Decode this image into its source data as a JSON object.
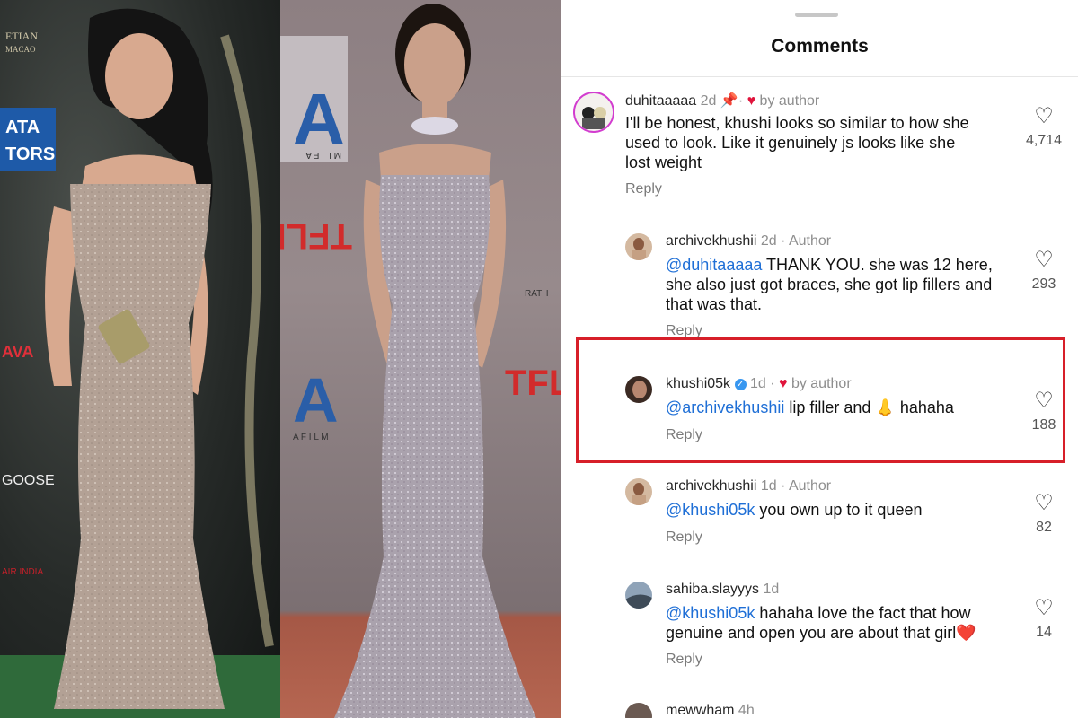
{
  "sheet": {
    "title": "Comments"
  },
  "comments": [
    {
      "username": "duhitaaaaa",
      "time": "2d",
      "pinned": true,
      "liked_by": "by author",
      "body": "I'll be honest, khushi looks so similar to how she used to look. Like it genuinely js looks like she lost weight",
      "reply_label": "Reply",
      "likes": "4,714"
    },
    {
      "username": "archivekhushii",
      "time": "2d",
      "badge": "Author",
      "mention": "@duhitaaaaa",
      "body": "THANK YOU. she was 12 here, she also just got braces, she got lip fillers and that was that.",
      "reply_label": "Reply",
      "likes": "293"
    },
    {
      "username": "khushi05k",
      "verified": true,
      "time": "1d",
      "liked_by": "by author",
      "mention": "@archivekhushii",
      "body": "lip filler and",
      "emoji": "👃",
      "body_tail": "hahaha",
      "reply_label": "Reply",
      "likes": "188"
    },
    {
      "username": "archivekhushii",
      "time": "1d",
      "badge": "Author",
      "mention": "@khushi05k",
      "body": "you own up to it queen",
      "reply_label": "Reply",
      "likes": "82"
    },
    {
      "username": "sahiba.slayyys",
      "time": "1d",
      "mention": "@khushi05k",
      "body": "hahaha love the fact that how genuine and open you are about that girl",
      "emoji": "❤️",
      "reply_label": "Reply",
      "likes": "14"
    },
    {
      "username": "mewwham",
      "time": "4h"
    }
  ],
  "photo_left": {
    "signage": [
      "ETIAN",
      "MACAO",
      "ATA",
      "TORS",
      "AVA",
      "GOOSE",
      "AIR INDIA"
    ]
  },
  "photo_right": {
    "signage": [
      "A",
      "M L I F A",
      "TFLIX",
      "RATH",
      "TFLIX",
      "A",
      "A F I L M"
    ]
  },
  "colors": {
    "mention": "#1f6fd6",
    "highlight": "#d71f29",
    "heart": "#e0143c"
  },
  "icons": [
    "heart-outline-icon",
    "pin-icon",
    "heart-filled-icon",
    "verified-badge-icon"
  ]
}
